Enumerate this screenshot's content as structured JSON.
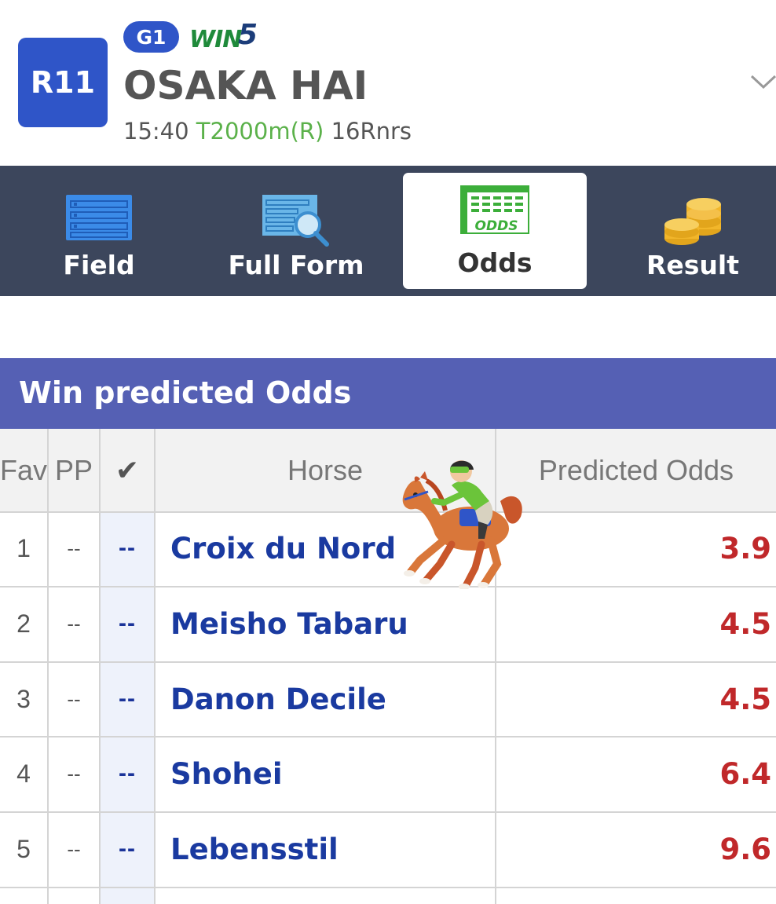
{
  "header": {
    "race_number": "R11",
    "grade": "G1",
    "win5_logo": "WIN5",
    "race_name": "OSAKA HAI",
    "post_time": "15:40",
    "course": "T2000m(R)",
    "runners": "16Rnrs",
    "expand_icon": "chevron-down-icon"
  },
  "tabs": [
    {
      "label": "Field",
      "icon": "list-icon",
      "active": false
    },
    {
      "label": "Full Form",
      "icon": "form-search-icon",
      "active": false
    },
    {
      "label": "Odds",
      "icon": "odds-sheet-icon",
      "icon_text": "ODDS",
      "active": true
    },
    {
      "label": "Result",
      "icon": "coins-icon",
      "active": false
    }
  ],
  "section": {
    "title": "Win predicted Odds"
  },
  "table": {
    "columns": {
      "fav": "Fav",
      "pp": "PP",
      "check": "✔",
      "horse": "Horse",
      "odds": "Predicted Odds"
    },
    "rows": [
      {
        "fav": "1",
        "pp": "--",
        "mark": "--",
        "horse": "Croix du Nord",
        "odds": "3.9"
      },
      {
        "fav": "2",
        "pp": "--",
        "mark": "--",
        "horse": "Meisho Tabaru",
        "odds": "4.5"
      },
      {
        "fav": "3",
        "pp": "--",
        "mark": "--",
        "horse": "Danon Decile",
        "odds": "4.5"
      },
      {
        "fav": "4",
        "pp": "--",
        "mark": "--",
        "horse": "Shohei",
        "odds": "6.4"
      },
      {
        "fav": "5",
        "pp": "--",
        "mark": "--",
        "horse": "Lebensstil",
        "odds": "9.6"
      }
    ]
  },
  "decoration": {
    "jockey_icon": "horse-racing-icon"
  },
  "colors": {
    "accent_blue": "#2f55c8",
    "tab_bar": "#3c465c",
    "section_header": "#5560b4",
    "horse_name": "#1a3aa0",
    "odds": "#c0282a",
    "course_green": "#5bb14a"
  }
}
